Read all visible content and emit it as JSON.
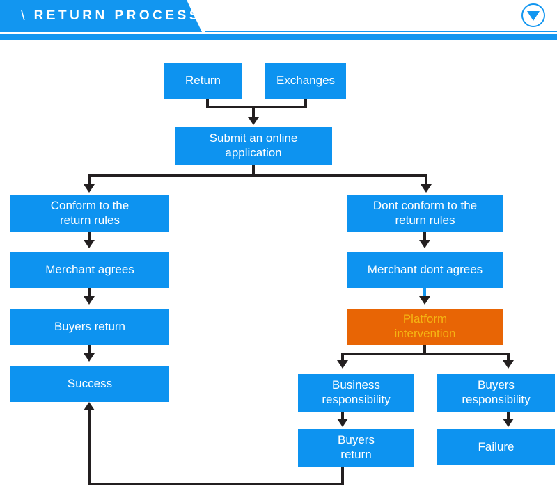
{
  "header": {
    "title": "RETURN PROCESS",
    "slash": "\\",
    "accent_color": "#1296f0",
    "dropdown_icon": "triangle-down-icon"
  },
  "palette": {
    "node_blue": "#0d93f0",
    "node_orange": "#e86505",
    "orange_text": "#f5b512",
    "connector_dark": "#231f20",
    "connector_blue": "#1296f0",
    "background": "#ffffff"
  },
  "flowchart": {
    "type": "flowchart",
    "title": "Return Process",
    "nodes": [
      {
        "id": "return",
        "label": "Return",
        "color": "blue"
      },
      {
        "id": "exchanges",
        "label": "Exchanges",
        "color": "blue"
      },
      {
        "id": "submit",
        "label": "Submit an online application",
        "color": "blue"
      },
      {
        "id": "conform",
        "label": "Conform to the return rules",
        "color": "blue"
      },
      {
        "id": "merch_agree",
        "label": "Merchant agrees",
        "color": "blue"
      },
      {
        "id": "buyers_ret_l",
        "label": "Buyers return",
        "color": "blue"
      },
      {
        "id": "success",
        "label": "Success",
        "color": "blue"
      },
      {
        "id": "dont_conform",
        "label": "Dont conform to the return rules",
        "color": "blue"
      },
      {
        "id": "merch_dont",
        "label": "Merchant dont agrees",
        "color": "blue"
      },
      {
        "id": "platform",
        "label": "Platform intervention",
        "color": "orange"
      },
      {
        "id": "biz_resp",
        "label": "Business responsibility",
        "color": "blue"
      },
      {
        "id": "buyers_resp",
        "label": "Buyers responsibility",
        "color": "blue"
      },
      {
        "id": "buyers_ret_r",
        "label": "Buyers return",
        "color": "blue"
      },
      {
        "id": "failure",
        "label": "Failure",
        "color": "blue"
      }
    ],
    "edges": [
      {
        "from": "return",
        "to": "submit"
      },
      {
        "from": "exchanges",
        "to": "submit"
      },
      {
        "from": "submit",
        "to": "conform"
      },
      {
        "from": "submit",
        "to": "dont_conform"
      },
      {
        "from": "conform",
        "to": "merch_agree"
      },
      {
        "from": "merch_agree",
        "to": "buyers_ret_l"
      },
      {
        "from": "buyers_ret_l",
        "to": "success"
      },
      {
        "from": "dont_conform",
        "to": "merch_dont"
      },
      {
        "from": "merch_dont",
        "to": "platform"
      },
      {
        "from": "platform",
        "to": "biz_resp"
      },
      {
        "from": "platform",
        "to": "buyers_resp"
      },
      {
        "from": "biz_resp",
        "to": "buyers_ret_r"
      },
      {
        "from": "buyers_resp",
        "to": "failure"
      },
      {
        "from": "buyers_ret_r",
        "to": "success"
      }
    ]
  },
  "labels": {
    "return": "Return",
    "exchanges": "Exchanges",
    "submit_l1": "Submit an online",
    "submit_l2": "application",
    "conform_l1": "Conform to the",
    "conform_l2": "return rules",
    "merchant_agrees": "Merchant agrees",
    "buyers_return_left": "Buyers return",
    "success": "Success",
    "dont_conform_l1": "Dont conform to the",
    "dont_conform_l2": "return rules",
    "merchant_dont_agrees": "Merchant dont agrees",
    "platform_l1": "Platform",
    "platform_l2": "intervention",
    "business_resp_l1": "Business",
    "business_resp_l2": "responsibility",
    "buyers_resp_l1": "Buyers",
    "buyers_resp_l2": "responsibility",
    "buyers_return_right_l1": "Buyers",
    "buyers_return_right_l2": "return",
    "failure": "Failure"
  }
}
